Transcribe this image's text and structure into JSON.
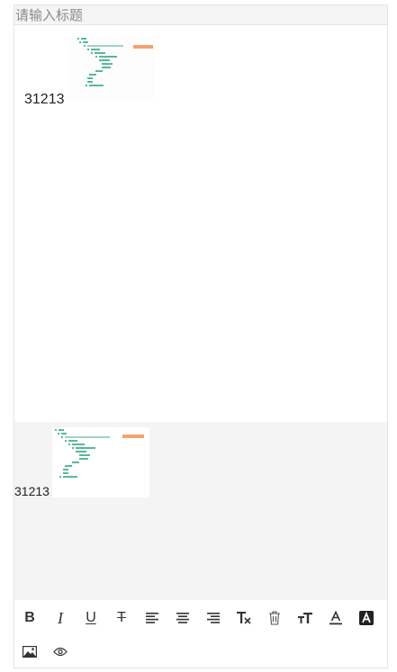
{
  "title": {
    "placeholder": "请输入标题",
    "value": ""
  },
  "editor": {
    "body_text": "31213",
    "image_icon": "document-screenshot-thumbnail"
  },
  "preview": {
    "body_text": "31213",
    "image_icon": "document-screenshot-thumbnail"
  },
  "toolbar": {
    "buttons": [
      {
        "name": "bold",
        "label": "B"
      },
      {
        "name": "italic",
        "label": "I"
      },
      {
        "name": "underline",
        "label": "U"
      },
      {
        "name": "strikethrough",
        "label": "T"
      },
      {
        "name": "align-left",
        "icon": "align-left-icon"
      },
      {
        "name": "align-center",
        "icon": "align-center-icon"
      },
      {
        "name": "align-right",
        "icon": "align-right-icon"
      },
      {
        "name": "clear-format",
        "icon": "clear-format-icon"
      },
      {
        "name": "delete",
        "icon": "trash-icon"
      },
      {
        "name": "font-size",
        "icon": "font-size-icon"
      },
      {
        "name": "font-color",
        "icon": "font-color-icon"
      },
      {
        "name": "background-color",
        "icon": "highlight-icon"
      },
      {
        "name": "insert-image",
        "icon": "image-icon"
      },
      {
        "name": "preview",
        "icon": "eye-icon"
      }
    ]
  }
}
